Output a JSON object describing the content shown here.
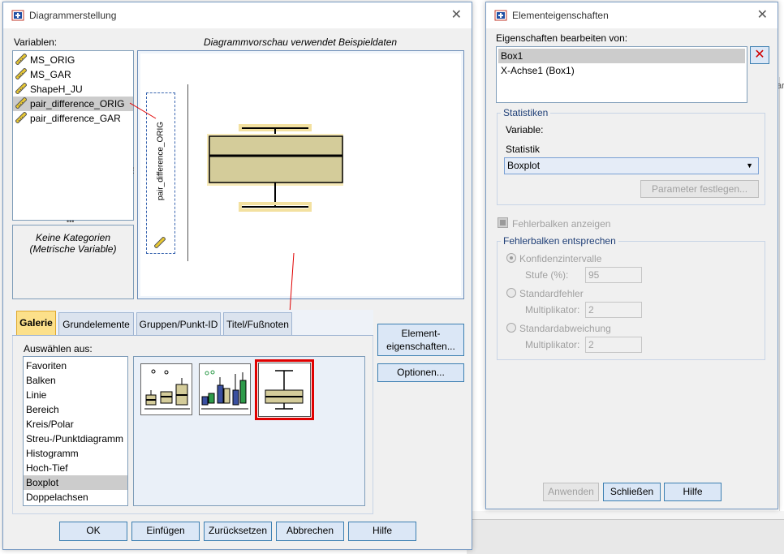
{
  "colors": {
    "accent": "#fce08a",
    "selection_border": "#e00000",
    "box_fill": "#d4cc9a"
  },
  "left_dialog": {
    "title": "Diagrammerstellung",
    "variables_label": "Variablen:",
    "variables": [
      {
        "name": "MS_ORIG",
        "icon": "scale-ruler-icon"
      },
      {
        "name": "MS_GAR",
        "icon": "scale-ruler-icon"
      },
      {
        "name": "ShapeH_JU",
        "icon": "scale-ruler-icon"
      },
      {
        "name": "pair_difference_ORIG",
        "icon": "scale-ruler-icon",
        "selected": true
      },
      {
        "name": "pair_difference_GAR",
        "icon": "scale-ruler-icon"
      }
    ],
    "no_categories_line1": "Keine Kategorien",
    "no_categories_line2": "(Metrische Variable)",
    "preview_caption": "Diagrammvorschau verwendet Beispieldaten",
    "y_axis_variable": "pair_difference_ORIG",
    "tabs": [
      "Galerie",
      "Grundelemente",
      "Gruppen/Punkt-ID",
      "Titel/Fußnoten"
    ],
    "active_tab": "Galerie",
    "choose_from_label": "Auswählen aus:",
    "gallery_types": [
      "Favoriten",
      "Balken",
      "Linie",
      "Bereich",
      "Kreis/Polar",
      "Streu-/Punktdiagramm",
      "Histogramm",
      "Hoch-Tief",
      "Boxplot",
      "Doppelachsen"
    ],
    "selected_type": "Boxplot",
    "element_properties_button_line1": "Element-",
    "element_properties_button_line2": "eigenschaften...",
    "options_button": "Optionen...",
    "footer_buttons": [
      "OK",
      "Einfügen",
      "Zurücksetzen",
      "Abbrechen",
      "Hilfe"
    ]
  },
  "right_dialog": {
    "title": "Elementeigenschaften",
    "edit_properties_label": "Eigenschaften bearbeiten von:",
    "elements": [
      "Box1",
      "X-Achse1 (Box1)"
    ],
    "selected_element": "Box1",
    "statistics_group": "Statistiken",
    "variable_label": "Variable:",
    "statistic_label": "Statistik",
    "statistic_value": "Boxplot",
    "set_parameters_button": "Parameter festlegen...",
    "error_bars_checkbox": "Fehlerbalken anzeigen",
    "error_bars_group": "Fehlerbalken entsprechen",
    "confidence_intervals": "Konfidenzintervalle",
    "level_label": "Stufe (%):",
    "level_value": "95",
    "standard_error": "Standardfehler",
    "multiplier_label": "Multiplikator:",
    "standard_error_multiplier": "2",
    "standard_deviation": "Standardabweichung",
    "standard_deviation_multiplier": "2",
    "apply_button": "Anwenden",
    "close_button": "Schließen",
    "help_button": "Hilfe"
  },
  "background": {
    "column_header_fragment": "ar"
  }
}
